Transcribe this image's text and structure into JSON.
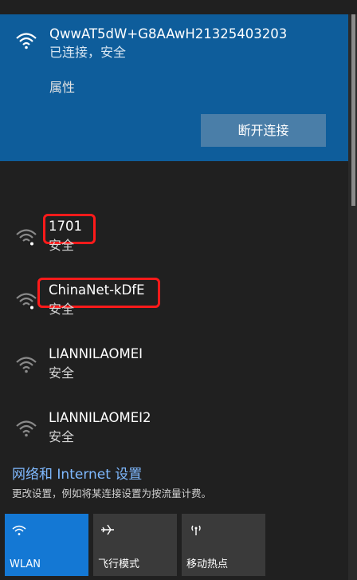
{
  "connected_network": {
    "ssid": "QwwAT5dW+G8AAwH21325403203",
    "status": "已连接，安全",
    "properties_label": "属性",
    "disconnect_label": "断开连接"
  },
  "networks": [
    {
      "ssid": "1701",
      "status": "安全",
      "highlighted": true
    },
    {
      "ssid": "ChinaNet-kDfE",
      "status": "安全",
      "highlighted": true
    },
    {
      "ssid": "LIANNILAOMEI",
      "status": "安全",
      "highlighted": false
    },
    {
      "ssid": "LIANNILAOMEI2",
      "status": "安全",
      "highlighted": false
    }
  ],
  "footer": {
    "settings_link": "网络和 Internet 设置",
    "description": "更改设置，例如将某连接设置为按流量计费。"
  },
  "quick_actions": [
    {
      "label": "WLAN",
      "icon": "wifi-icon",
      "active": true
    },
    {
      "label": "飞行模式",
      "icon": "airplane-icon",
      "active": false
    },
    {
      "label": "移动热点",
      "icon": "hotspot-icon",
      "active": false
    }
  ],
  "colors": {
    "connected_bg": "#0e5d9b",
    "accent": "#1478d4",
    "highlight": "#ff1a1a",
    "link": "#7fb9ff"
  }
}
